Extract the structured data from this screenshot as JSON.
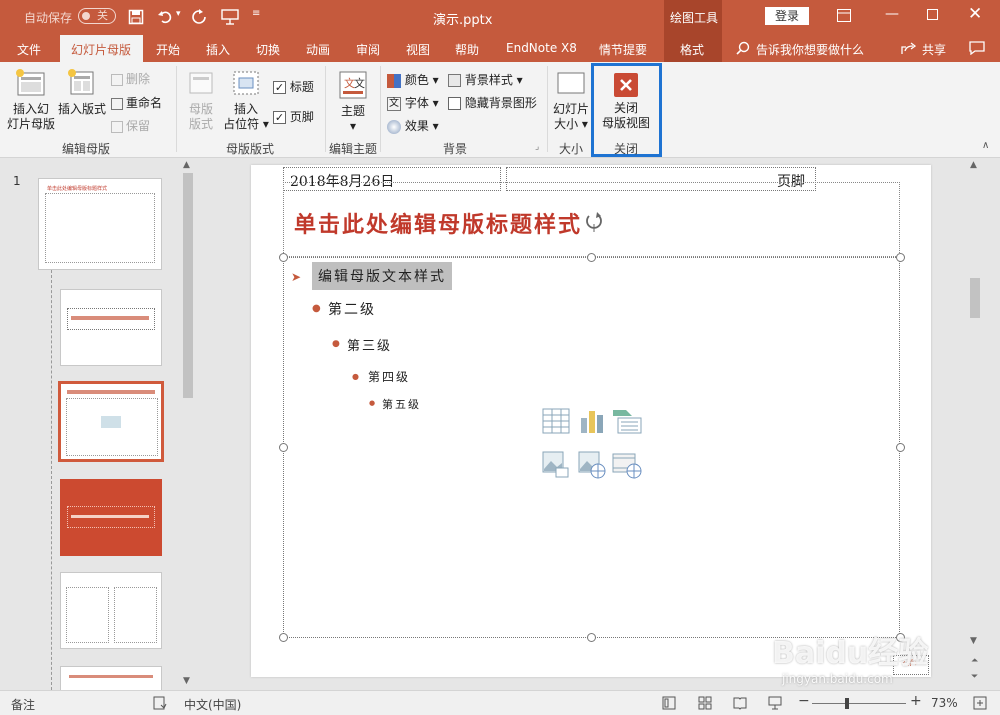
{
  "titlebar": {
    "autosave_label": "自动保存",
    "autosave_state": "关",
    "doc_title": "演示.pptx",
    "context_tool": "绘图工具",
    "login": "登录"
  },
  "tabs": [
    "文件",
    "幻灯片母版",
    "开始",
    "插入",
    "切换",
    "动画",
    "审阅",
    "视图",
    "帮助",
    "EndNote X8",
    "情节提要",
    "格式"
  ],
  "search_placeholder": "告诉我你想要做什么",
  "share": "共享",
  "ribbon": {
    "insert_slide_master": [
      "插入幻",
      "灯片母版"
    ],
    "insert_layout": "插入版式",
    "delete": "删除",
    "rename": "重命名",
    "preserve": "保留",
    "group_edit_master": "编辑母版",
    "master_layout": [
      "母版",
      "版式"
    ],
    "insert_placeholder": [
      "插入",
      "占位符"
    ],
    "title_check": "标题",
    "footer_check": "页脚",
    "group_master_layout": "母版版式",
    "themes": "主题",
    "group_edit_theme": "编辑主题",
    "colors": "颜色",
    "fonts": "字体",
    "effects": "效果",
    "bg_styles": "背景样式",
    "hide_bg": "隐藏背景图形",
    "group_background": "背景",
    "slide_size": [
      "幻灯片",
      "大小"
    ],
    "group_size": "大小",
    "close_master": [
      "关闭",
      "母版视图"
    ],
    "group_close": "关闭",
    "accent_color": "#c55a3d",
    "highlight_color": "#1e73d2"
  },
  "thumbnails": {
    "slide_number": "1",
    "master_title": "单击此处编辑母版标题样式"
  },
  "slide": {
    "date": "2018年8月26日",
    "footer": "页脚",
    "title": "单击此处编辑母版标题样式",
    "levels": [
      "编辑母版文本样式",
      "第二级",
      "第三级",
      "第四级",
      "第五级"
    ],
    "page_number": "‹#›",
    "title_color": "#c0392b"
  },
  "status": {
    "notes": "备注",
    "language": "中文(中国)",
    "zoom": "73%"
  },
  "watermark": {
    "brand": "Baidu经验",
    "url": "jingyan.baidu.com"
  }
}
